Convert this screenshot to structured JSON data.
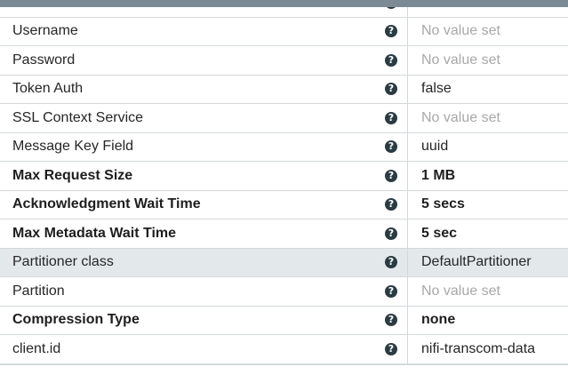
{
  "help_glyph": "?",
  "help_icon": "question-circle-icon",
  "properties": [
    {
      "name": "",
      "value": "",
      "required": false,
      "unset": false,
      "highlight": false
    },
    {
      "name": "Username",
      "value": "No value set",
      "required": false,
      "unset": true,
      "highlight": false
    },
    {
      "name": "Password",
      "value": "No value set",
      "required": false,
      "unset": true,
      "highlight": false
    },
    {
      "name": "Token Auth",
      "value": "false",
      "required": false,
      "unset": false,
      "highlight": false
    },
    {
      "name": "SSL Context Service",
      "value": "No value set",
      "required": false,
      "unset": true,
      "highlight": false
    },
    {
      "name": "Message Key Field",
      "value": "uuid",
      "required": false,
      "unset": false,
      "highlight": false
    },
    {
      "name": "Max Request Size",
      "value": "1 MB",
      "required": true,
      "unset": false,
      "highlight": false
    },
    {
      "name": "Acknowledgment Wait Time",
      "value": "5 secs",
      "required": true,
      "unset": false,
      "highlight": false
    },
    {
      "name": "Max Metadata Wait Time",
      "value": "5 sec",
      "required": true,
      "unset": false,
      "highlight": false
    },
    {
      "name": "Partitioner class",
      "value": "DefaultPartitioner",
      "required": false,
      "unset": false,
      "highlight": true
    },
    {
      "name": "Partition",
      "value": "No value set",
      "required": false,
      "unset": true,
      "highlight": false
    },
    {
      "name": "Compression Type",
      "value": "none",
      "required": true,
      "unset": false,
      "highlight": false
    },
    {
      "name": "client.id",
      "value": "nifi-transcom-data",
      "required": false,
      "unset": false,
      "highlight": false
    }
  ]
}
